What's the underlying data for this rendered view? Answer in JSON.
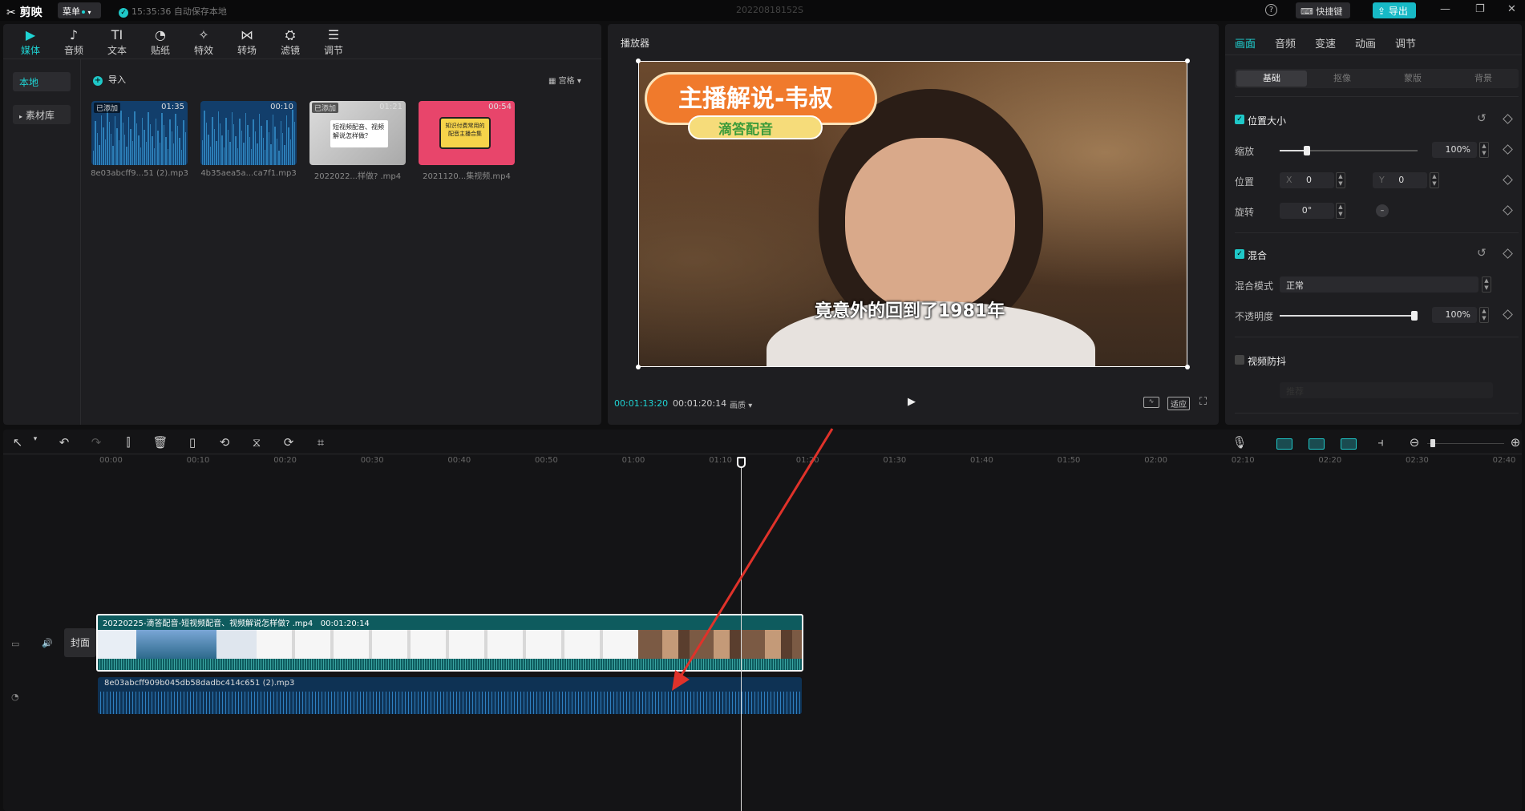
{
  "titlebar": {
    "app_name": "剪映",
    "menu_label": "菜单",
    "autosave": "15:35:36 自动保存本地",
    "project_title": "20220818152S",
    "shortcut_label": "快捷键",
    "export_label": "导出"
  },
  "media_toolbar": {
    "tabs": [
      {
        "label": "媒体",
        "icon": "media-icon",
        "glyph": "▶"
      },
      {
        "label": "音频",
        "icon": "audio-icon",
        "glyph": "♪"
      },
      {
        "label": "文本",
        "icon": "text-icon",
        "glyph": "TI"
      },
      {
        "label": "贴纸",
        "icon": "sticker-icon",
        "glyph": "◔"
      },
      {
        "label": "特效",
        "icon": "effects-icon",
        "glyph": "✧"
      },
      {
        "label": "转场",
        "icon": "transition-icon",
        "glyph": "⋈"
      },
      {
        "label": "滤镜",
        "icon": "filter-icon",
        "glyph": "⛭"
      },
      {
        "label": "调节",
        "icon": "adjust-icon",
        "glyph": "☰"
      }
    ]
  },
  "media_side": {
    "local": "本地",
    "library": "素材库"
  },
  "media_panel": {
    "import_label": "导入",
    "view_label": "宫格",
    "items": [
      {
        "name": "8e03abcff9...51 (2).mp3",
        "badge": "已添加",
        "duration": "01:35",
        "kind": "audio"
      },
      {
        "name": "4b35aea5a...ca7f1.mp3",
        "badge": "",
        "duration": "00:10",
        "kind": "audio"
      },
      {
        "name": "2022022...样做? .mp4",
        "badge": "已添加",
        "duration": "01:21",
        "kind": "video-white",
        "caption": "短视频配音、视频解说怎样做？"
      },
      {
        "name": "2021120...集视频.mp4",
        "badge": "",
        "duration": "00:54",
        "kind": "video-pink",
        "caption": "知识付费常用的配音主播合集"
      }
    ]
  },
  "player": {
    "title": "播放器",
    "banner_title": "主播解说-韦叔",
    "banner_sub": "滴答配音",
    "subtitle": "竟意外的回到了1981年",
    "current_time": "00:01:13:20",
    "total_time": "00:01:20:14",
    "ratio_label": "画质",
    "fit_label": "适应"
  },
  "right_panel": {
    "tabs": [
      "画面",
      "音频",
      "变速",
      "动画",
      "调节"
    ],
    "sub_tabs": [
      "基础",
      "抠像",
      "蒙版",
      "背景"
    ],
    "pos_size_title": "位置大小",
    "scale_label": "缩放",
    "scale_value": "100%",
    "scale_level": 0.2,
    "position_label": "位置",
    "x_label": "X",
    "x_value": "0",
    "y_label": "Y",
    "y_value": "0",
    "rotate_label": "旋转",
    "rotate_value": "0°",
    "blend_title": "混合",
    "blend_mode_label": "混合模式",
    "blend_mode_value": "正常",
    "opacity_label": "不透明度",
    "opacity_value": "100%",
    "opacity_level": 1.0,
    "stabilize_label": "视频防抖",
    "stabilize_level_value": "推荐"
  },
  "timeline": {
    "ruler": [
      "00:00",
      "00:10",
      "00:20",
      "00:30",
      "00:40",
      "00:50",
      "01:00",
      "01:10",
      "01:20",
      "01:30",
      "01:40",
      "01:50",
      "02:00",
      "02:10",
      "02:20",
      "02:30",
      "02:40"
    ],
    "cover_label": "封面",
    "video_clip_name": "20220225-滴答配音-短视频配音、视频解说怎样做? .mp4",
    "video_clip_duration": "00:01:20:14",
    "audio_clip_name": "8e03abcff909b045db58dadbc414c651 (2).mp3",
    "colors": {
      "accent": "#1fc8c8",
      "video_clip": "#0e5b5e",
      "audio_clip": "#0e3254",
      "arrow": "#e0322a"
    }
  }
}
